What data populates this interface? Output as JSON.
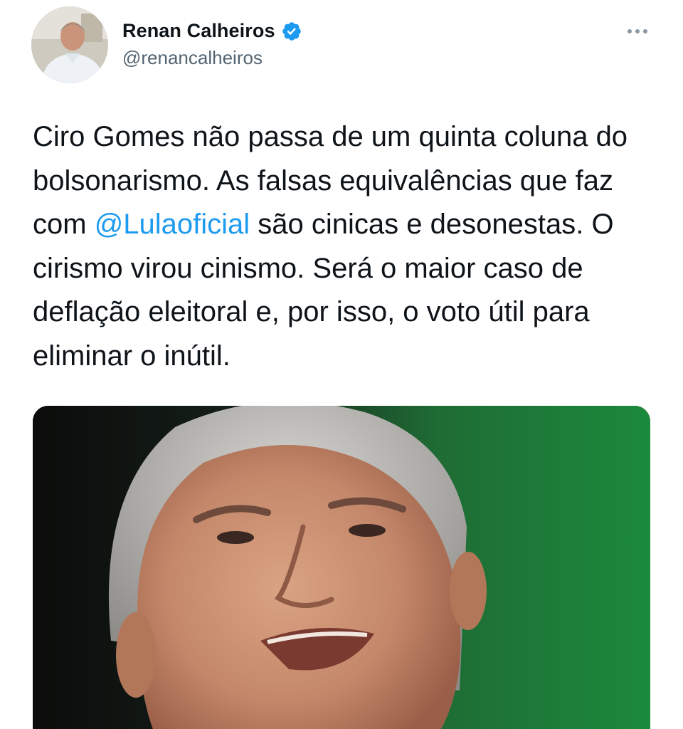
{
  "author": {
    "display_name": "Renan Calheiros",
    "handle": "@renancalheiros",
    "verified": true,
    "avatar_icon": "profile-photo"
  },
  "tweet": {
    "text_before_mention": "Ciro Gomes não passa de um quinta coluna do bolsonarismo. As falsas equivalências que faz com ",
    "mention": "@Lulaoficial",
    "text_after_mention": " são cinicas e desonestas. O cirismo virou cinismo. Será o maior caso de deflação eleitoral e, por isso, o voto útil para eliminar o inútil."
  },
  "media": {
    "type": "photo",
    "icon": "man-portrait-photo"
  },
  "colors": {
    "link": "#1d9bf0",
    "verified": "#1d9bf0",
    "text": "#0f1419",
    "secondary": "#536471"
  }
}
